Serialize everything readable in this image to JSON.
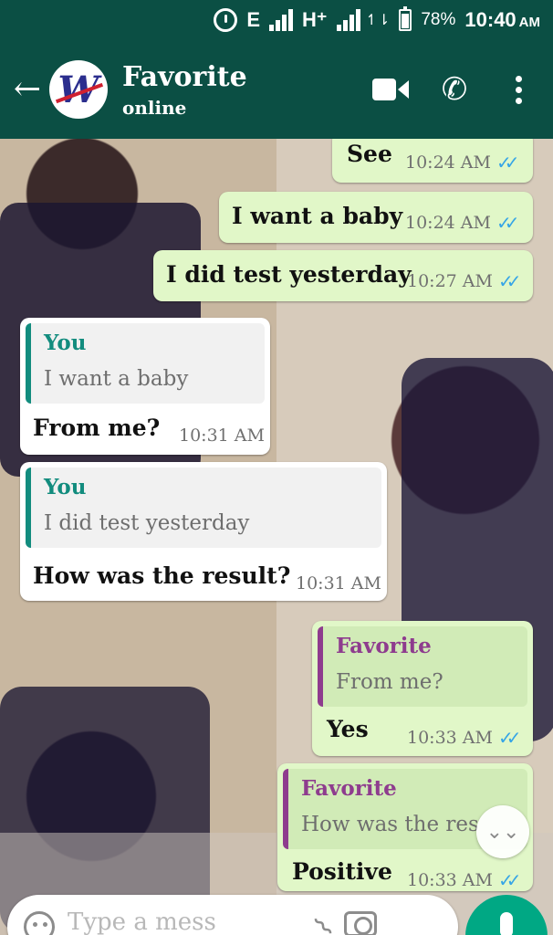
{
  "status_bar": {
    "network": "E",
    "network2": "H⁺",
    "updown": "↿⇂",
    "battery": "78%",
    "time": "10:40",
    "ampm": "AM"
  },
  "header": {
    "back": "←",
    "contact_name": "Favorite",
    "contact_status": "online",
    "avatar_letter": "W"
  },
  "messages": [
    {
      "dir": "out",
      "text": "See",
      "time": "10:24 AM"
    },
    {
      "dir": "out",
      "text": "I want a baby",
      "time": "10:24 AM"
    },
    {
      "dir": "out",
      "text": "I did test yesterday",
      "time": "10:27 AM"
    },
    {
      "dir": "in",
      "quote_author": "You",
      "quote_text": "I want a baby",
      "text": "From me?",
      "time": "10:31 AM"
    },
    {
      "dir": "in",
      "quote_author": "You",
      "quote_text": "I did test yesterday",
      "text": "How was the result?",
      "time": "10:31 AM"
    },
    {
      "dir": "out",
      "quote_author": "Favorite",
      "quote_text": "From me?",
      "text": "Yes",
      "time": "10:33 AM"
    },
    {
      "dir": "out",
      "quote_author": "Favorite",
      "quote_text": "How was the res",
      "text": "Positive",
      "time": "10:33 AM"
    }
  ],
  "ticks": "✓✓",
  "scroll_down": "⌄⌄",
  "composer": {
    "placeholder": "Type a mess",
    "attach": "⌇"
  },
  "colors": {
    "teal_dark": "#0b4f44",
    "you_quote": "#128c7e",
    "favorite_quote": "#8e3c8e",
    "ticks_blue": "#36a5e6",
    "out_bubble": "#e1f7c8",
    "mic_green": "#00a884"
  }
}
